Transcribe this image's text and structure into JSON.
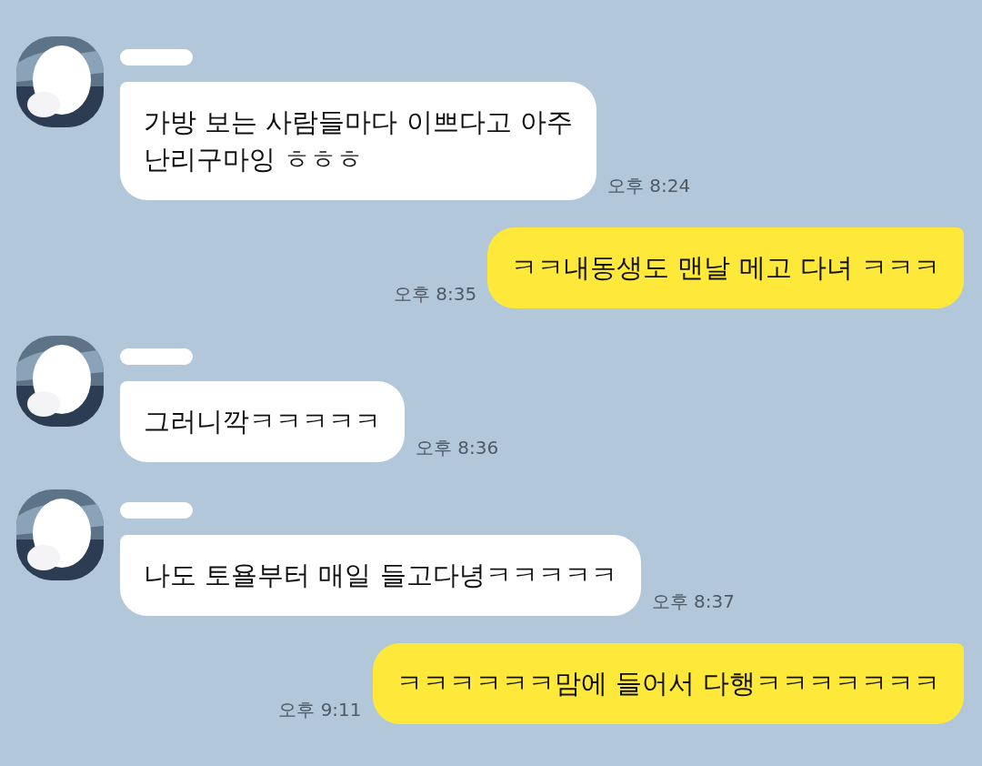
{
  "messages": [
    {
      "kind": "received",
      "text": "가방 보는 사람들마다 이쁘다고 아주\n난리구마잉 ㅎㅎㅎ",
      "time": "오후 8:24"
    },
    {
      "kind": "sent",
      "text": "ㅋㅋ내동생도 맨날 메고 다녀 ㅋㅋㅋ",
      "time": "오후 8:35"
    },
    {
      "kind": "received",
      "text": "그러니깍ㅋㅋㅋㅋㅋ",
      "time": "오후 8:36"
    },
    {
      "kind": "received",
      "text": "나도 토욜부터 매일 들고다녕ㅋㅋㅋㅋㅋ",
      "time": "오후 8:37"
    },
    {
      "kind": "sent",
      "text": "ㅋㅋㅋㅋㅋㅋ맘에 들어서 다행ㅋㅋㅋㅋㅋㅋㅋ",
      "time": "오후 9:11"
    }
  ]
}
